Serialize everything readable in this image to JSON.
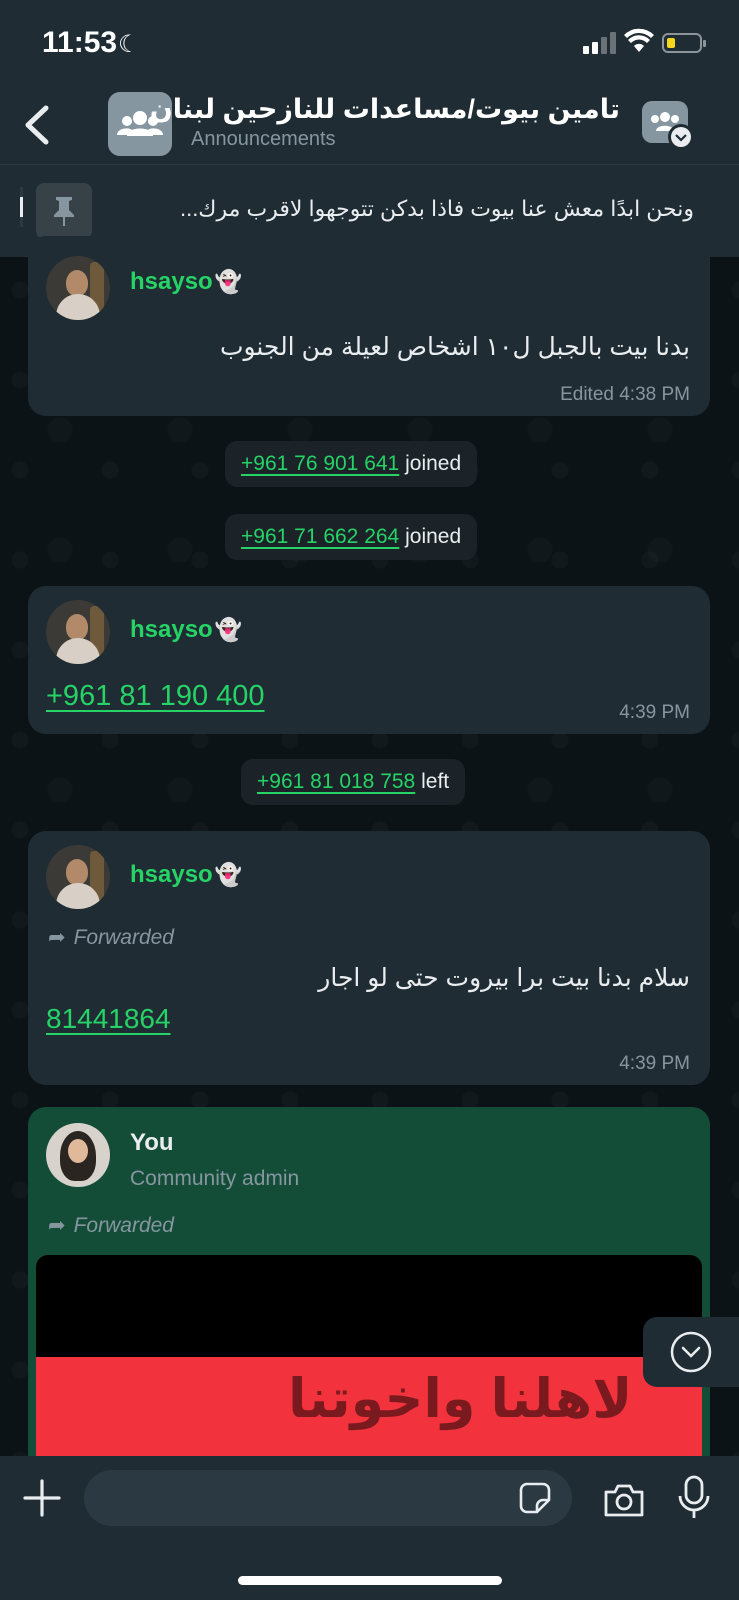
{
  "status": {
    "time": "11:53",
    "battery_color": "#f7d51d"
  },
  "header": {
    "title": "تامين بيوت/مساعدات للنازحين لبنان",
    "subtitle": "Announcements"
  },
  "pinned": {
    "text": "ونحن ابدًا معش عنا بيوت فاذا بدكن تتوجهوا لاقرب مرك..."
  },
  "messages": [
    {
      "sender": "hsayso",
      "emoji": "👻",
      "text": "بدنا بيت بالجبل ل١٠ اشخاص لعيلة من الجنوب",
      "meta": "Edited 4:38 PM"
    },
    {
      "sender": "hsayso",
      "emoji": "👻",
      "link": "+961 81 190 400",
      "meta": "4:39 PM"
    },
    {
      "sender": "hsayso",
      "emoji": "👻",
      "forwarded": "Forwarded",
      "text": "سلام بدنا بيت برا بيروت حتى لو اجار",
      "link": "81441864",
      "meta": "4:39 PM"
    },
    {
      "sender": "You",
      "role": "Community admin",
      "forwarded": "Forwarded",
      "image_text": "لاهلنا واخوتنا"
    }
  ],
  "system": [
    {
      "phone": "+961 76 901 641",
      "action": "joined"
    },
    {
      "phone": "+961 71 662 264",
      "action": "joined"
    },
    {
      "phone": "+961 81 018 758",
      "action": "left"
    }
  ],
  "composer": {
    "value": "",
    "placeholder": ""
  },
  "colors": {
    "accent": "#25d366",
    "outgoing_bubble": "#144d37",
    "incoming_bubble": "#202c33"
  }
}
